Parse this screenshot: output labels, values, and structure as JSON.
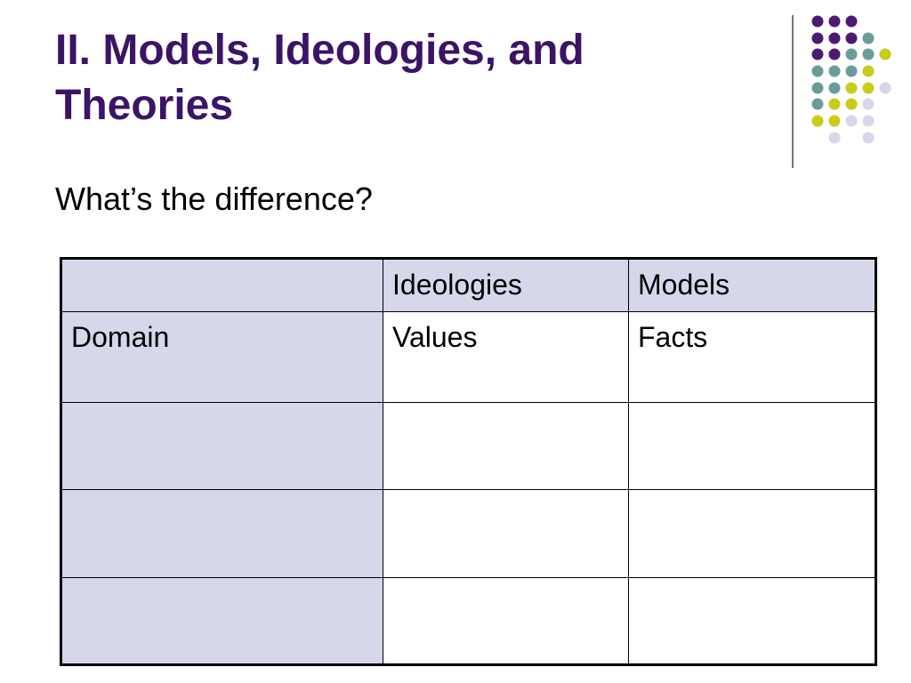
{
  "slide": {
    "title_line1": "II. Models, Ideologies, and",
    "title_line2": "Theories",
    "subtitle": "What’s the difference?"
  },
  "decor": {
    "dot_colors": {
      "purple": "#4b1b74",
      "teal": "#6b9c9a",
      "yellow": "#c8cc1a",
      "lavender": "#d6d7eb"
    },
    "divider_color": "#777777"
  },
  "table": {
    "header_fill": "#d6d7eb",
    "columns": [
      "",
      "Ideologies",
      "Models"
    ],
    "rows": [
      [
        "Domain",
        "Values",
        "Facts"
      ],
      [
        "",
        "",
        ""
      ],
      [
        "",
        "",
        ""
      ],
      [
        "",
        "",
        ""
      ]
    ]
  }
}
